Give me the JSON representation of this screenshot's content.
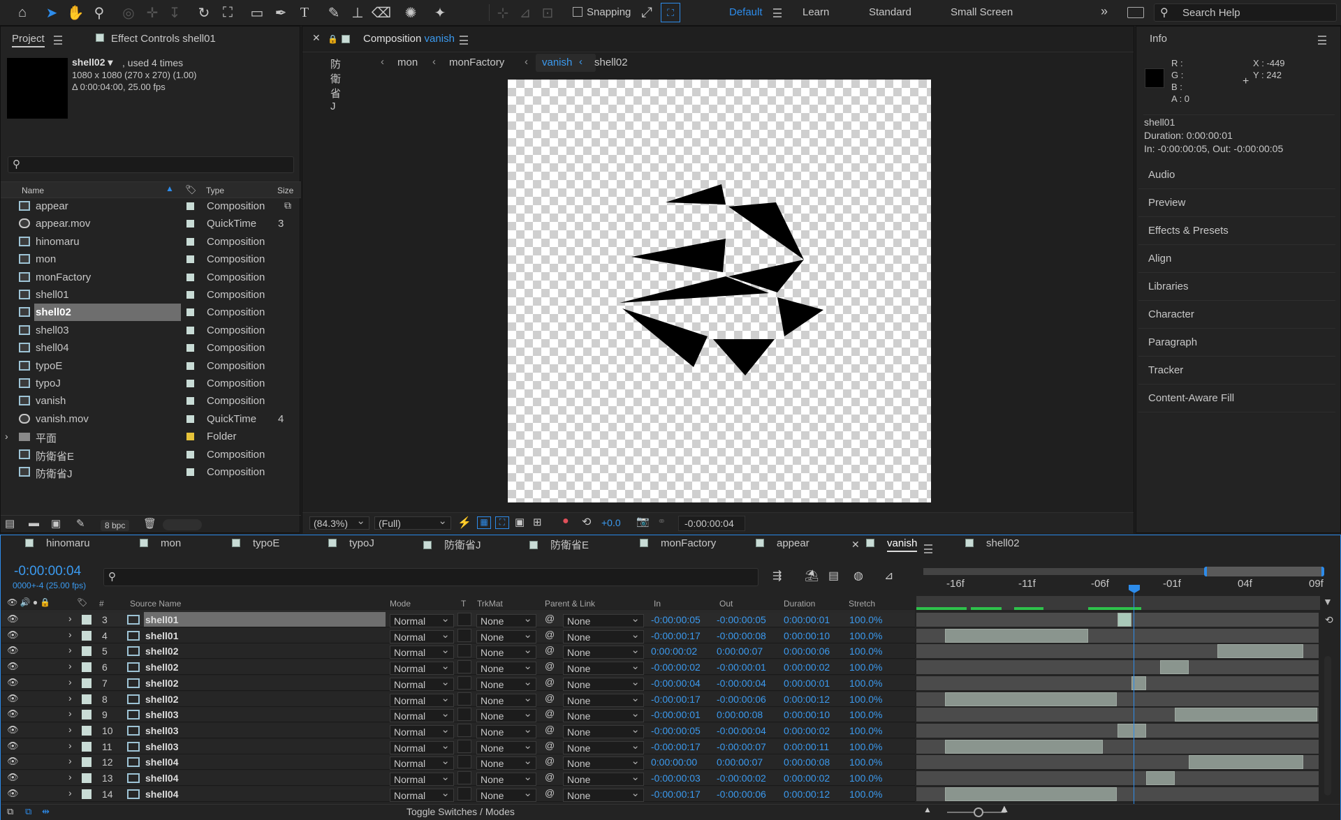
{
  "workspaces": {
    "default": "Default",
    "learn": "Learn",
    "standard": "Standard",
    "small": "Small Screen",
    "search": "Search Help",
    "snapping": "Snapping"
  },
  "project": {
    "tab": "Project",
    "effect_controls": "Effect Controls shell01",
    "selected_name": "shell02 ▾",
    "used": ", used 4 times",
    "dims": "1080 x 1080  (270 x 270) (1.00)",
    "duration": "Δ 0:00:04:00, 25.00 fps",
    "columns": {
      "name": "Name",
      "type": "Type",
      "size": "Size"
    },
    "items": [
      {
        "name": "appear",
        "type": "Composition",
        "size": "",
        "kind": "comp"
      },
      {
        "name": "appear.mov",
        "type": "QuickTime",
        "size": "3",
        "kind": "mov"
      },
      {
        "name": "hinomaru",
        "type": "Composition",
        "size": "",
        "kind": "comp"
      },
      {
        "name": "mon",
        "type": "Composition",
        "size": "",
        "kind": "comp"
      },
      {
        "name": "monFactory",
        "type": "Composition",
        "size": "",
        "kind": "comp"
      },
      {
        "name": "shell01",
        "type": "Composition",
        "size": "",
        "kind": "comp"
      },
      {
        "name": "shell02",
        "type": "Composition",
        "size": "",
        "kind": "comp"
      },
      {
        "name": "shell03",
        "type": "Composition",
        "size": "",
        "kind": "comp"
      },
      {
        "name": "shell04",
        "type": "Composition",
        "size": "",
        "kind": "comp"
      },
      {
        "name": "typoE",
        "type": "Composition",
        "size": "",
        "kind": "comp"
      },
      {
        "name": "typoJ",
        "type": "Composition",
        "size": "",
        "kind": "comp"
      },
      {
        "name": "vanish",
        "type": "Composition",
        "size": "",
        "kind": "comp"
      },
      {
        "name": "vanish.mov",
        "type": "QuickTime",
        "size": "4",
        "kind": "mov"
      },
      {
        "name": "平面",
        "type": "Folder",
        "size": "",
        "kind": "folder"
      },
      {
        "name": "防衛省E",
        "type": "Composition",
        "size": "",
        "kind": "comp"
      },
      {
        "name": "防衛省J",
        "type": "Composition",
        "size": "",
        "kind": "comp"
      }
    ],
    "bpc": "8 bpc"
  },
  "comp": {
    "tab_prefix": "Composition",
    "tab_name": "vanish",
    "breadcrumbs": [
      "防衛省J",
      "mon",
      "monFactory",
      "vanish",
      "shell02"
    ],
    "zoom": "(84.3%)",
    "resolution": "(Full)",
    "exposure": "+0.0",
    "timecode": "-0:00:00:04"
  },
  "info": {
    "title": "Info",
    "r": "R :",
    "g": "G :",
    "b": "B :",
    "a": "A :  0",
    "x": "X : -449",
    "y": "Y :  242",
    "layer": "shell01",
    "duration": "Duration: 0:00:00:01",
    "inout": "In: -0:00:00:05, Out: -0:00:00:05",
    "panels": [
      "Audio",
      "Preview",
      "Effects & Presets",
      "Align",
      "Libraries",
      "Character",
      "Paragraph",
      "Tracker",
      "Content-Aware Fill"
    ]
  },
  "timeline": {
    "tabs": [
      "hinomaru",
      "mon",
      "typoE",
      "typoJ",
      "防衛省J",
      "防衛省E",
      "monFactory",
      "appear",
      "vanish",
      "shell02"
    ],
    "timecode": "-0:00:00:04",
    "frame_info": "0000+-4 (25.00 fps)",
    "columns": {
      "num": "#",
      "source": "Source Name",
      "mode": "Mode",
      "t": "T",
      "trkmat": "TrkMat",
      "parent": "Parent & Link",
      "in": "In",
      "out": "Out",
      "duration": "Duration",
      "stretch": "Stretch"
    },
    "ruler": [
      "-16f",
      "-11f",
      "-06f",
      "-01f",
      "04f",
      "09f"
    ],
    "toggle": "Toggle Switches / Modes",
    "layers": [
      {
        "num": "3",
        "name": "shell01",
        "mode": "Normal",
        "trkmat": "None",
        "parent": "None",
        "in": "-0:00:00:05",
        "out": "-0:00:00:05",
        "dur": "0:00:00:01",
        "stretch": "100.0%"
      },
      {
        "num": "4",
        "name": "shell01",
        "mode": "Normal",
        "trkmat": "None",
        "parent": "None",
        "in": "-0:00:00:17",
        "out": "-0:00:00:08",
        "dur": "0:00:00:10",
        "stretch": "100.0%"
      },
      {
        "num": "5",
        "name": "shell02",
        "mode": "Normal",
        "trkmat": "None",
        "parent": "None",
        "in": "0:00:00:02",
        "out": "0:00:00:07",
        "dur": "0:00:00:06",
        "stretch": "100.0%"
      },
      {
        "num": "6",
        "name": "shell02",
        "mode": "Normal",
        "trkmat": "None",
        "parent": "None",
        "in": "-0:00:00:02",
        "out": "-0:00:00:01",
        "dur": "0:00:00:02",
        "stretch": "100.0%"
      },
      {
        "num": "7",
        "name": "shell02",
        "mode": "Normal",
        "trkmat": "None",
        "parent": "None",
        "in": "-0:00:00:04",
        "out": "-0:00:00:04",
        "dur": "0:00:00:01",
        "stretch": "100.0%"
      },
      {
        "num": "8",
        "name": "shell02",
        "mode": "Normal",
        "trkmat": "None",
        "parent": "None",
        "in": "-0:00:00:17",
        "out": "-0:00:00:06",
        "dur": "0:00:00:12",
        "stretch": "100.0%"
      },
      {
        "num": "9",
        "name": "shell03",
        "mode": "Normal",
        "trkmat": "None",
        "parent": "None",
        "in": "-0:00:00:01",
        "out": "0:00:00:08",
        "dur": "0:00:00:10",
        "stretch": "100.0%"
      },
      {
        "num": "10",
        "name": "shell03",
        "mode": "Normal",
        "trkmat": "None",
        "parent": "None",
        "in": "-0:00:00:05",
        "out": "-0:00:00:04",
        "dur": "0:00:00:02",
        "stretch": "100.0%"
      },
      {
        "num": "11",
        "name": "shell03",
        "mode": "Normal",
        "trkmat": "None",
        "parent": "None",
        "in": "-0:00:00:17",
        "out": "-0:00:00:07",
        "dur": "0:00:00:11",
        "stretch": "100.0%"
      },
      {
        "num": "12",
        "name": "shell04",
        "mode": "Normal",
        "trkmat": "None",
        "parent": "None",
        "in": "0:00:00:00",
        "out": "0:00:00:07",
        "dur": "0:00:00:08",
        "stretch": "100.0%"
      },
      {
        "num": "13",
        "name": "shell04",
        "mode": "Normal",
        "trkmat": "None",
        "parent": "None",
        "in": "-0:00:00:03",
        "out": "-0:00:00:02",
        "dur": "0:00:00:02",
        "stretch": "100.0%"
      },
      {
        "num": "14",
        "name": "shell04",
        "mode": "Normal",
        "trkmat": "None",
        "parent": "None",
        "in": "-0:00:00:17",
        "out": "-0:00:00:06",
        "dur": "0:00:00:12",
        "stretch": "100.0%"
      }
    ]
  }
}
